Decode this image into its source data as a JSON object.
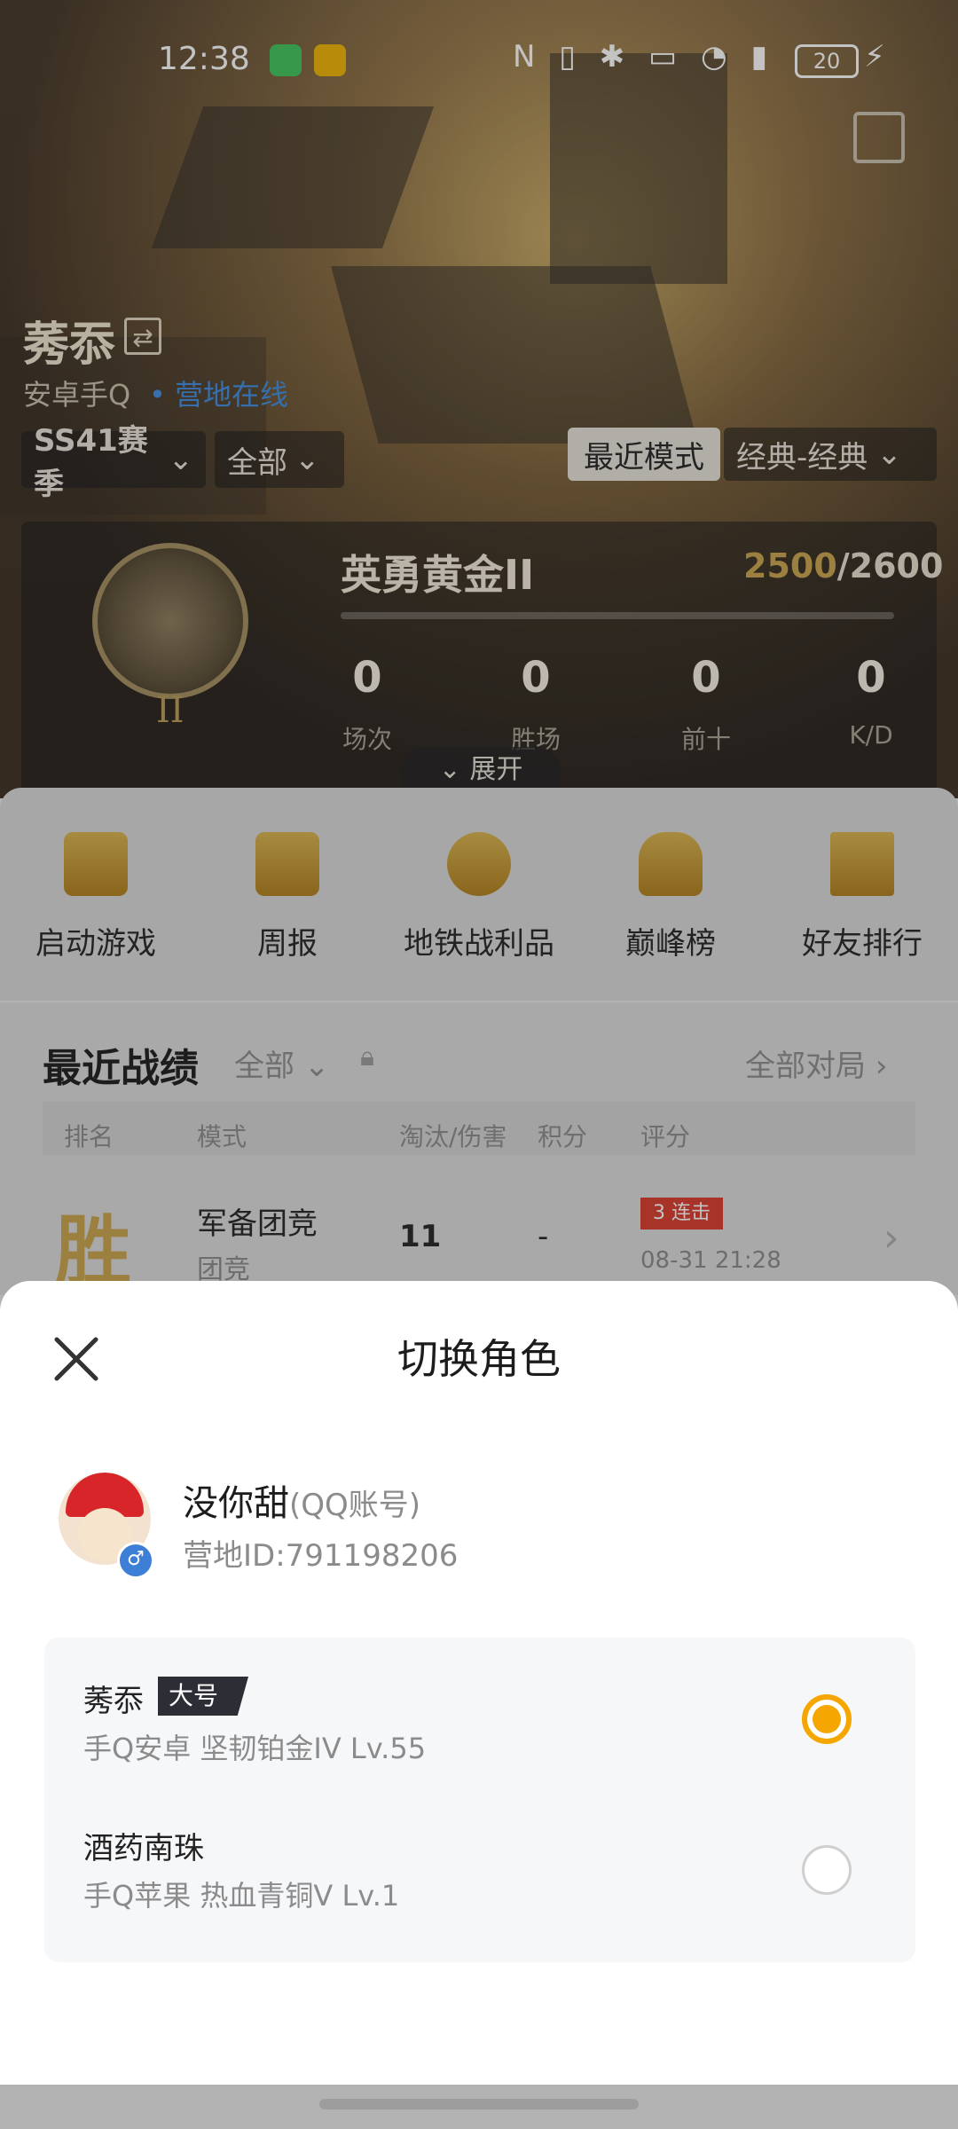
{
  "status_bar": {
    "time": "12:38",
    "battery": "20"
  },
  "profile": {
    "name": "莠忝",
    "platform": "安卓手Q",
    "online_status": "营地在线",
    "season_filter": "SS41赛季",
    "scope_filter": "全部",
    "mode_tab": "最近模式",
    "mode_select": "经典-经典",
    "rank_title": "英勇黄金II",
    "rank_badge_numeral": "II",
    "points_current": "2500",
    "points_total": "/2600",
    "stats": [
      {
        "value": "0",
        "label": "场次"
      },
      {
        "value": "0",
        "label": "胜场"
      },
      {
        "value": "0",
        "label": "前十"
      },
      {
        "value": "0",
        "label": "K/D"
      }
    ],
    "expand_label": "展开"
  },
  "shortcuts": [
    {
      "label": "启动游戏",
      "icon": "lightning-icon"
    },
    {
      "label": "周报",
      "icon": "calendar-icon"
    },
    {
      "label": "地铁战利品",
      "icon": "metro-icon"
    },
    {
      "label": "巅峰榜",
      "icon": "trophy-icon"
    },
    {
      "label": "好友排行",
      "icon": "podium-icon"
    }
  ],
  "recent": {
    "title": "最近战绩",
    "filter": "全部",
    "all_matches": "全部对局",
    "headers": [
      "排名",
      "模式",
      "淘汰/伤害",
      "积分",
      "评分"
    ],
    "row": {
      "result": "胜",
      "mode": "军备团竞",
      "submode": "团竞",
      "kills": "11",
      "score": "-",
      "streak_num": "3",
      "streak_label": "连击",
      "datetime": "08-31 21:28"
    }
  },
  "sheet": {
    "title": "切换角色",
    "account": {
      "name": "没你甜",
      "type": "(QQ账号)",
      "camp_id": "营地ID:791198206"
    },
    "roles": [
      {
        "name": "莠忝",
        "tag": "大号",
        "platform": "手Q安卓",
        "rank": "坚韧铂金IV",
        "level": "Lv.55",
        "selected": true
      },
      {
        "name": "酒药南珠",
        "tag": "",
        "platform": "手Q苹果",
        "rank": "热血青铜V",
        "level": "Lv.1",
        "selected": false
      }
    ]
  },
  "colors": {
    "accent": "#f5a600",
    "streak": "#d9382a",
    "win": "#c9a24a"
  }
}
